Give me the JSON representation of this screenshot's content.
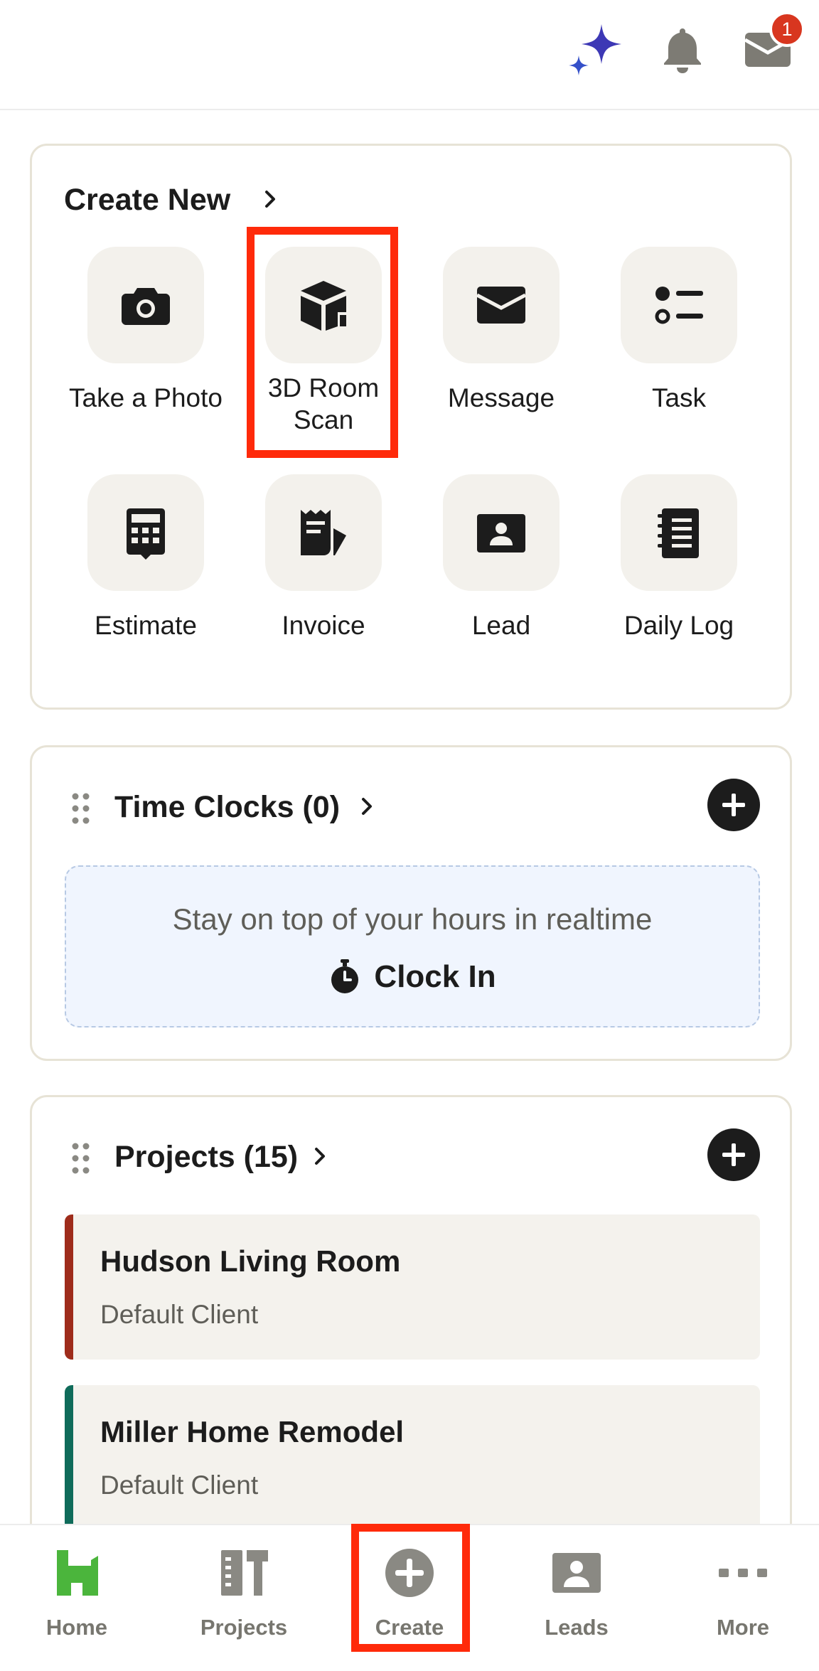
{
  "topbar": {
    "notification_count": "1",
    "colors": {
      "sparkle": "#3d38b5",
      "bell": "#7d7b74",
      "inbox": "#7d7b74",
      "badge": "#d8361f"
    }
  },
  "create_new": {
    "title": "Create New",
    "tiles": [
      {
        "label": "Take a Photo",
        "icon": "camera-icon"
      },
      {
        "label": "3D Room Scan",
        "icon": "cube-scan-icon"
      },
      {
        "label": "Message",
        "icon": "envelope-icon"
      },
      {
        "label": "Task",
        "icon": "task-list-icon"
      },
      {
        "label": "Estimate",
        "icon": "calculator-icon"
      },
      {
        "label": "Invoice",
        "icon": "invoice-icon"
      },
      {
        "label": "Lead",
        "icon": "contact-card-icon"
      },
      {
        "label": "Daily Log",
        "icon": "notebook-icon"
      }
    ]
  },
  "time_clocks": {
    "title": "Time Clocks (0)",
    "hint": "Stay on top of your hours in realtime",
    "clock_in_label": "Clock In"
  },
  "projects": {
    "title": "Projects (15)",
    "items": [
      {
        "name": "Hudson Living Room",
        "client": "Default Client",
        "color": "#9e2c1b"
      },
      {
        "name": "Miller Home Remodel",
        "client": "Default Client",
        "color": "#0f6b5a"
      }
    ]
  },
  "bottom_nav": {
    "items": [
      {
        "label": "Home",
        "icon": "home-icon",
        "color": "#4bb53c"
      },
      {
        "label": "Projects",
        "icon": "projects-icon"
      },
      {
        "label": "Create",
        "icon": "plus-circle-icon"
      },
      {
        "label": "Leads",
        "icon": "leads-icon"
      },
      {
        "label": "More",
        "icon": "more-dots-icon"
      }
    ]
  },
  "highlight_color": "#ff2a0a"
}
